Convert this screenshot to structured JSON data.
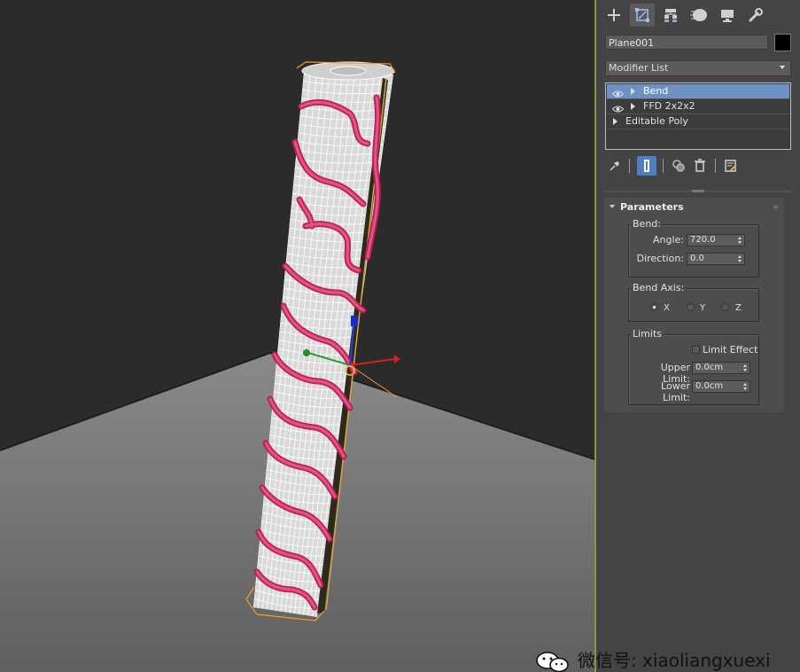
{
  "command_panel": {
    "tabs": [
      {
        "name": "create-tab-plus-icon",
        "active": false
      },
      {
        "name": "modify-tab-icon",
        "active": true
      },
      {
        "name": "hierarchy-tab-icon",
        "active": false
      },
      {
        "name": "motion-tab-icon",
        "active": false
      },
      {
        "name": "display-tab-icon",
        "active": false
      },
      {
        "name": "utilities-tab-wrench-icon",
        "active": false
      }
    ],
    "object_name": "Plane001",
    "object_color": "#000000",
    "modifier_list_label": "Modifier List",
    "stack": [
      {
        "label": "Bend",
        "selected": true,
        "eye": true,
        "expand": true
      },
      {
        "label": "FFD 2x2x2",
        "selected": false,
        "eye": true,
        "expand": true
      },
      {
        "label": "Editable Poly",
        "selected": false,
        "eye": false,
        "expand": true
      }
    ]
  },
  "parameters": {
    "title": "Parameters",
    "bend_group": {
      "title": "Bend:",
      "angle_label": "Angle:",
      "angle_value": "720.0",
      "direction_label": "Direction:",
      "direction_value": "0.0"
    },
    "axis_group": {
      "title": "Bend Axis:",
      "options": [
        "X",
        "Y",
        "Z"
      ],
      "selected": "X"
    },
    "limits_group": {
      "title": "Limits",
      "limit_effect_label": "Limit Effect",
      "limit_effect_checked": false,
      "upper_label": "Upper Limit:",
      "upper_value": "0.0cm",
      "lower_label": "Lower Limit:",
      "lower_value": "0.0cm"
    }
  },
  "viewport": {
    "object_description_colors": {
      "wireframe": "#ffffff",
      "ribbon": "#d2356f",
      "bounding_box": "#f39a2b"
    }
  },
  "watermark": {
    "text": "微信号: xiaoliangxuexi"
  }
}
